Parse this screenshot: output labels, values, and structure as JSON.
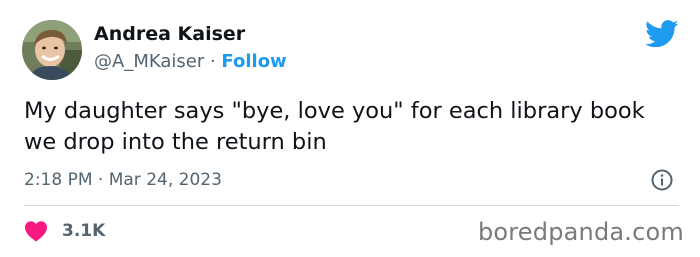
{
  "author": {
    "name": "Andrea Kaiser",
    "handle": "@A_MKaiser",
    "separator": "·",
    "follow_label": "Follow"
  },
  "tweet": {
    "text": "My daughter says \"bye, love you\" for each library book we drop into the return bin",
    "time": "2:18 PM",
    "date_separator": "·",
    "date": "Mar 24, 2023"
  },
  "engagement": {
    "likes": "3.1K"
  },
  "watermark": "boredpanda.com",
  "icons": {
    "brand": "twitter-bird-icon",
    "info": "info-icon",
    "like": "heart-icon"
  },
  "colors": {
    "accent": "#1d9bf0",
    "like": "#f91880",
    "muted": "#536471",
    "text": "#0f1419"
  }
}
